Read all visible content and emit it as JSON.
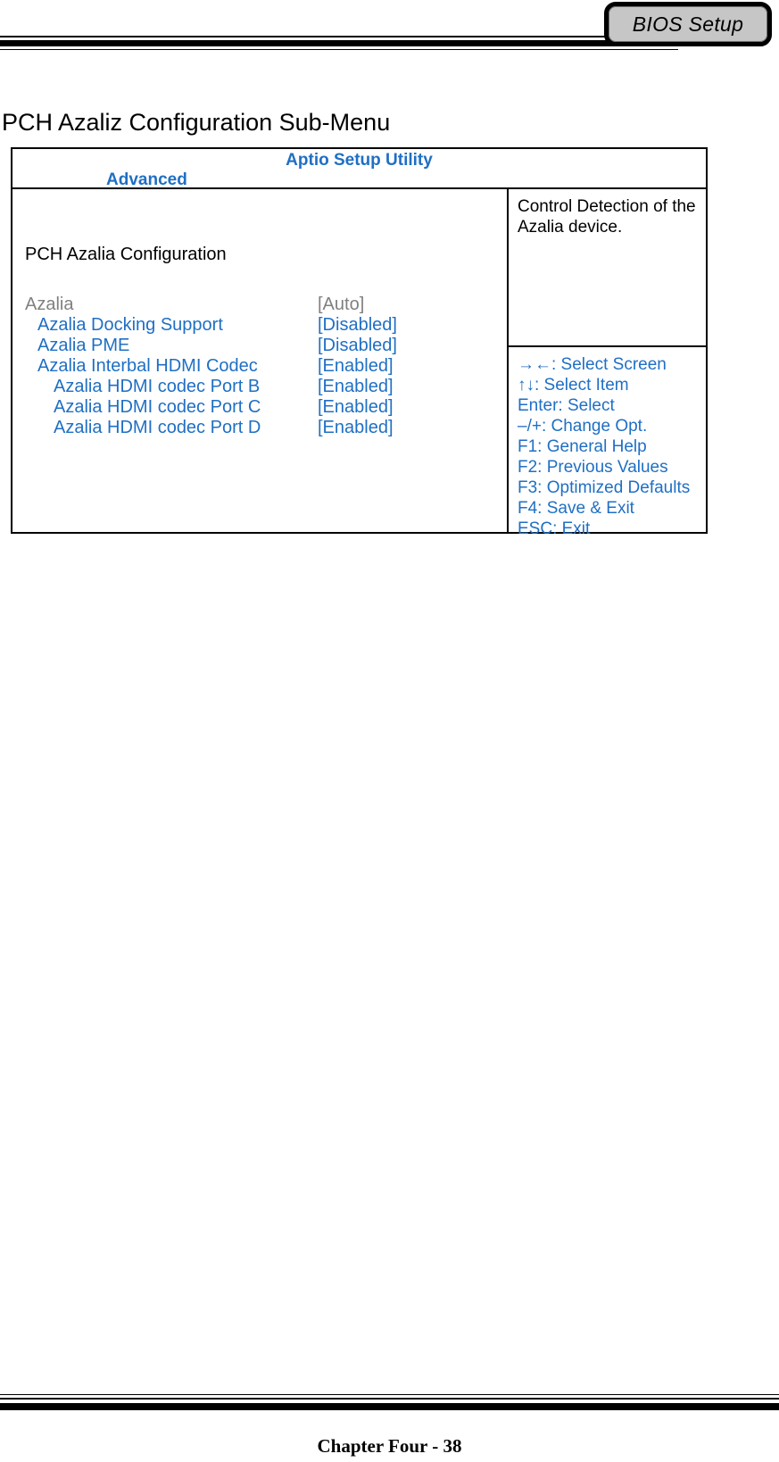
{
  "header": {
    "badge_label": "BIOS Setup"
  },
  "page_title": "PCH Azaliz Configuration Sub-Menu",
  "bios": {
    "utility_title": "Aptio Setup Utility",
    "menu_tab": "Advanced",
    "section_heading": "PCH Azalia Configuration",
    "items": [
      {
        "label": "Azalia",
        "value": "[Auto]",
        "indent": 0,
        "tone": "gray"
      },
      {
        "label": "Azalia Docking Support",
        "value": "[Disabled]",
        "indent": 1,
        "tone": "blue"
      },
      {
        "label": "Azalia PME",
        "value": "[Disabled]",
        "indent": 1,
        "tone": "blue"
      },
      {
        "label": "Azalia Interbal HDMI Codec",
        "value": "[Enabled]",
        "indent": 1,
        "tone": "blue"
      },
      {
        "label": "Azalia HDMI codec Port B",
        "value": "[Enabled]",
        "indent": 2,
        "tone": "blue"
      },
      {
        "label": "Azalia HDMI codec Port C",
        "value": "[Enabled]",
        "indent": 2,
        "tone": "blue"
      },
      {
        "label": "Azalia HDMI codec Port D",
        "value": "[Enabled]",
        "indent": 2,
        "tone": "blue"
      }
    ],
    "help_text": "Control Detection of the Azalia device.",
    "key_legend": [
      "→←: Select Screen",
      "↑↓: Select Item",
      "Enter: Select",
      "–/+: Change Opt.",
      "F1: General Help",
      "F2: Previous Values",
      "F3: Optimized Defaults",
      "F4: Save & Exit",
      "ESC: Exit"
    ]
  },
  "footer": {
    "text": "Chapter Four - 38"
  },
  "colors": {
    "accent_blue": "#1f6fc4",
    "disabled_gray": "#808080",
    "badge_fill": "#c6c6c6"
  }
}
